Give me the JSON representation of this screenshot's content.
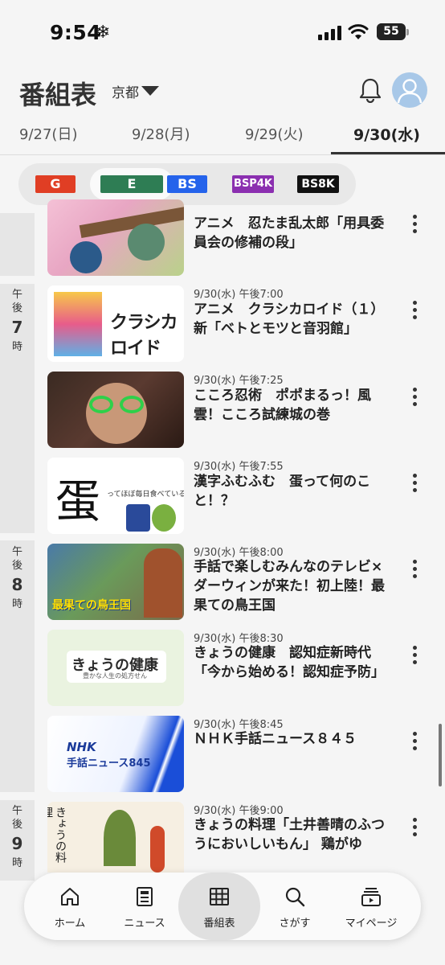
{
  "status": {
    "time": "9:54",
    "snow_icon": "❄",
    "battery": "55"
  },
  "header": {
    "title": "番組表",
    "region": "京都"
  },
  "date_tabs": [
    {
      "label": "9/27(日)",
      "active": false
    },
    {
      "label": "9/28(月)",
      "active": false
    },
    {
      "label": "9/29(火)",
      "active": false
    },
    {
      "label": "9/30(水)",
      "active": true
    }
  ],
  "channels": [
    {
      "label": "G",
      "color": "#e03e24"
    },
    {
      "label": "E",
      "color": "#2e7d54"
    },
    {
      "label": "BS",
      "color": "#2563eb"
    },
    {
      "label": "BSP4K",
      "color": "#8b2fb0"
    },
    {
      "label": "BS8K",
      "color": "#111111"
    }
  ],
  "hours": [
    {
      "ampm": "午後",
      "hour": "7",
      "suffix": "時"
    },
    {
      "ampm": "午後",
      "hour": "8",
      "suffix": "時"
    },
    {
      "ampm": "午後",
      "hour": "9",
      "suffix": "時"
    }
  ],
  "programs": [
    {
      "time": "",
      "title": "アニメ　忍たま乱太郎「用具委員会の修補の段」"
    },
    {
      "time": "9/30(水) 午後7:00",
      "title": "アニメ　クラシカロイド（１）新「ベトとモツと音羽館」"
    },
    {
      "time": "9/30(水) 午後7:25",
      "title": "こころ忍術　ポポまるっ！風雲！こころ試練城の巻"
    },
    {
      "time": "9/30(水) 午後7:55",
      "title": "漢字ふむふむ　蛋って何のこと！？",
      "thumb_text": "蛋",
      "thumb_sub": "ってほぼ毎日食べている。"
    },
    {
      "time": "9/30(水) 午後8:00",
      "title": "手話で楽しむみんなのテレビ×ダーウィンが来た！初上陸！最果ての鳥王国",
      "thumb_text": "最果ての鳥王国"
    },
    {
      "time": "9/30(水) 午後8:30",
      "title": "きょうの健康　認知症新時代「今から始める！認知症予防」",
      "thumb_text": "きょうの健康",
      "thumb_sub": "豊かな人生の処方せん"
    },
    {
      "time": "9/30(水) 午後8:45",
      "title": "ＮＨＫ手話ニュース８４５",
      "thumb_text": "NHK",
      "thumb_sub": "手話ニュース845"
    },
    {
      "time": "9/30(水) 午後9:00",
      "title": "きょうの料理「土井善晴のふつうにおいしいもん」 鶏がゆ",
      "thumb_text": "きょうの料理"
    }
  ],
  "nav": [
    {
      "label": "ホーム",
      "icon": "home-icon"
    },
    {
      "label": "ニュース",
      "icon": "news-icon"
    },
    {
      "label": "番組表",
      "icon": "grid-icon",
      "active": true
    },
    {
      "label": "さがす",
      "icon": "search-icon"
    },
    {
      "label": "マイページ",
      "icon": "mypage-icon"
    }
  ]
}
